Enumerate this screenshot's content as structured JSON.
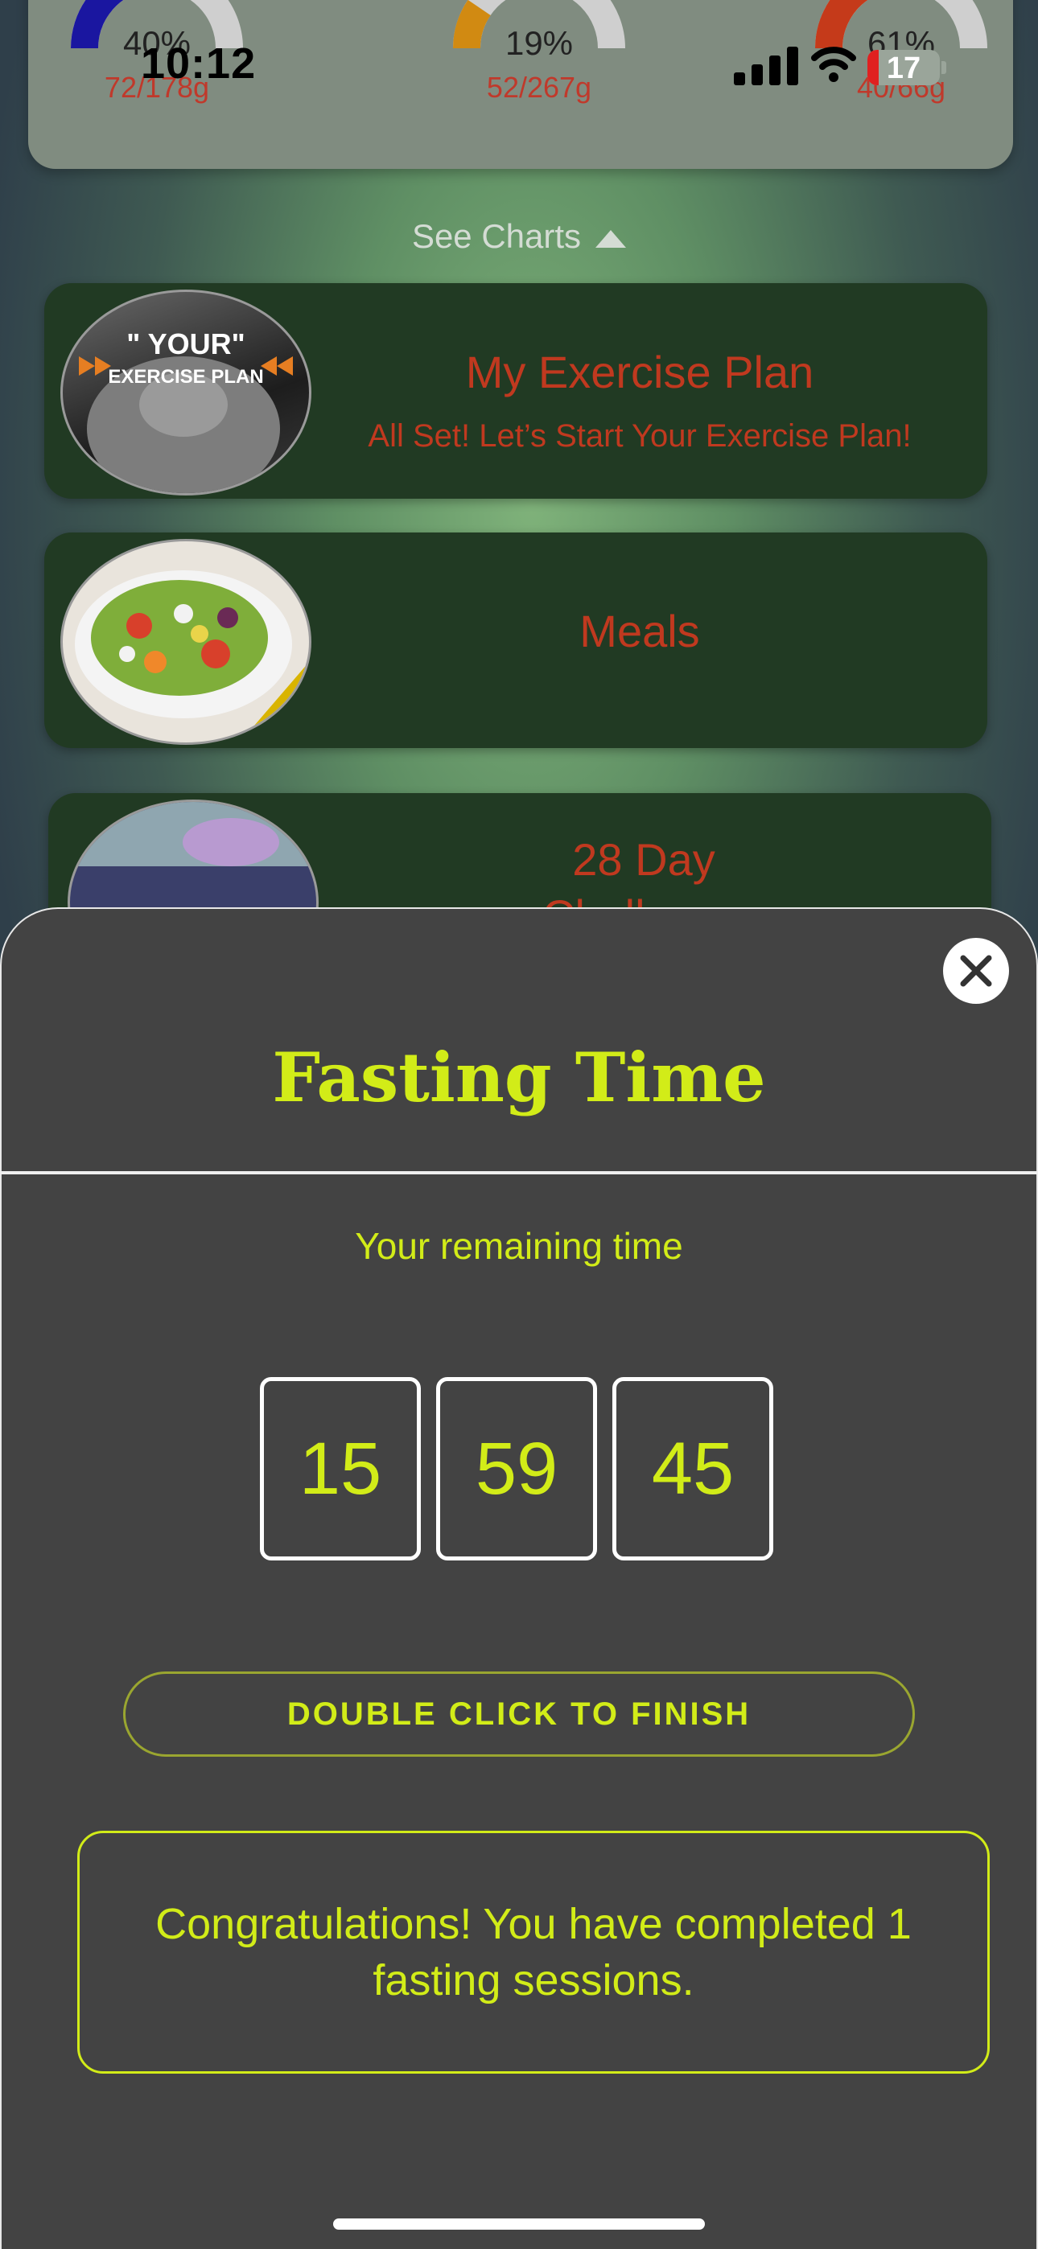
{
  "status_bar": {
    "time": "10:12",
    "battery": "17"
  },
  "macros": [
    {
      "percent": "40%",
      "amount": "72/178g",
      "fraction": 0.4,
      "color": "#1a16a0"
    },
    {
      "percent": "19%",
      "amount": "52/267g",
      "fraction": 0.19,
      "color": "#d18a12"
    },
    {
      "percent": "61%",
      "amount": "40/66g",
      "fraction": 0.61,
      "color": "#c53a1a"
    }
  ],
  "see_charts": "See Charts",
  "tiles": [
    {
      "title": "My Exercise Plan",
      "subtitle": "All Set! Let’s Start Your Exercise Plan!",
      "image_text_1": "\" YOUR\"",
      "image_text_2": "EXERCISE PLAN"
    },
    {
      "title": "Meals"
    },
    {
      "title": "28 Day",
      "title_line2": "Challenge"
    }
  ],
  "sheet": {
    "title": "Fasting Time",
    "remaining_label": "Your remaining time",
    "time": {
      "hours": "15",
      "minutes": "59",
      "seconds": "45"
    },
    "finish_button": "DOUBLE CLICK TO FINISH",
    "message": "Congratulations! You have completed 1 fasting sessions."
  },
  "colors": {
    "accent": "#d2ec18",
    "tile_bg": "#213a23",
    "tile_text": "#c0391f",
    "sheet_bg": "#434343"
  }
}
